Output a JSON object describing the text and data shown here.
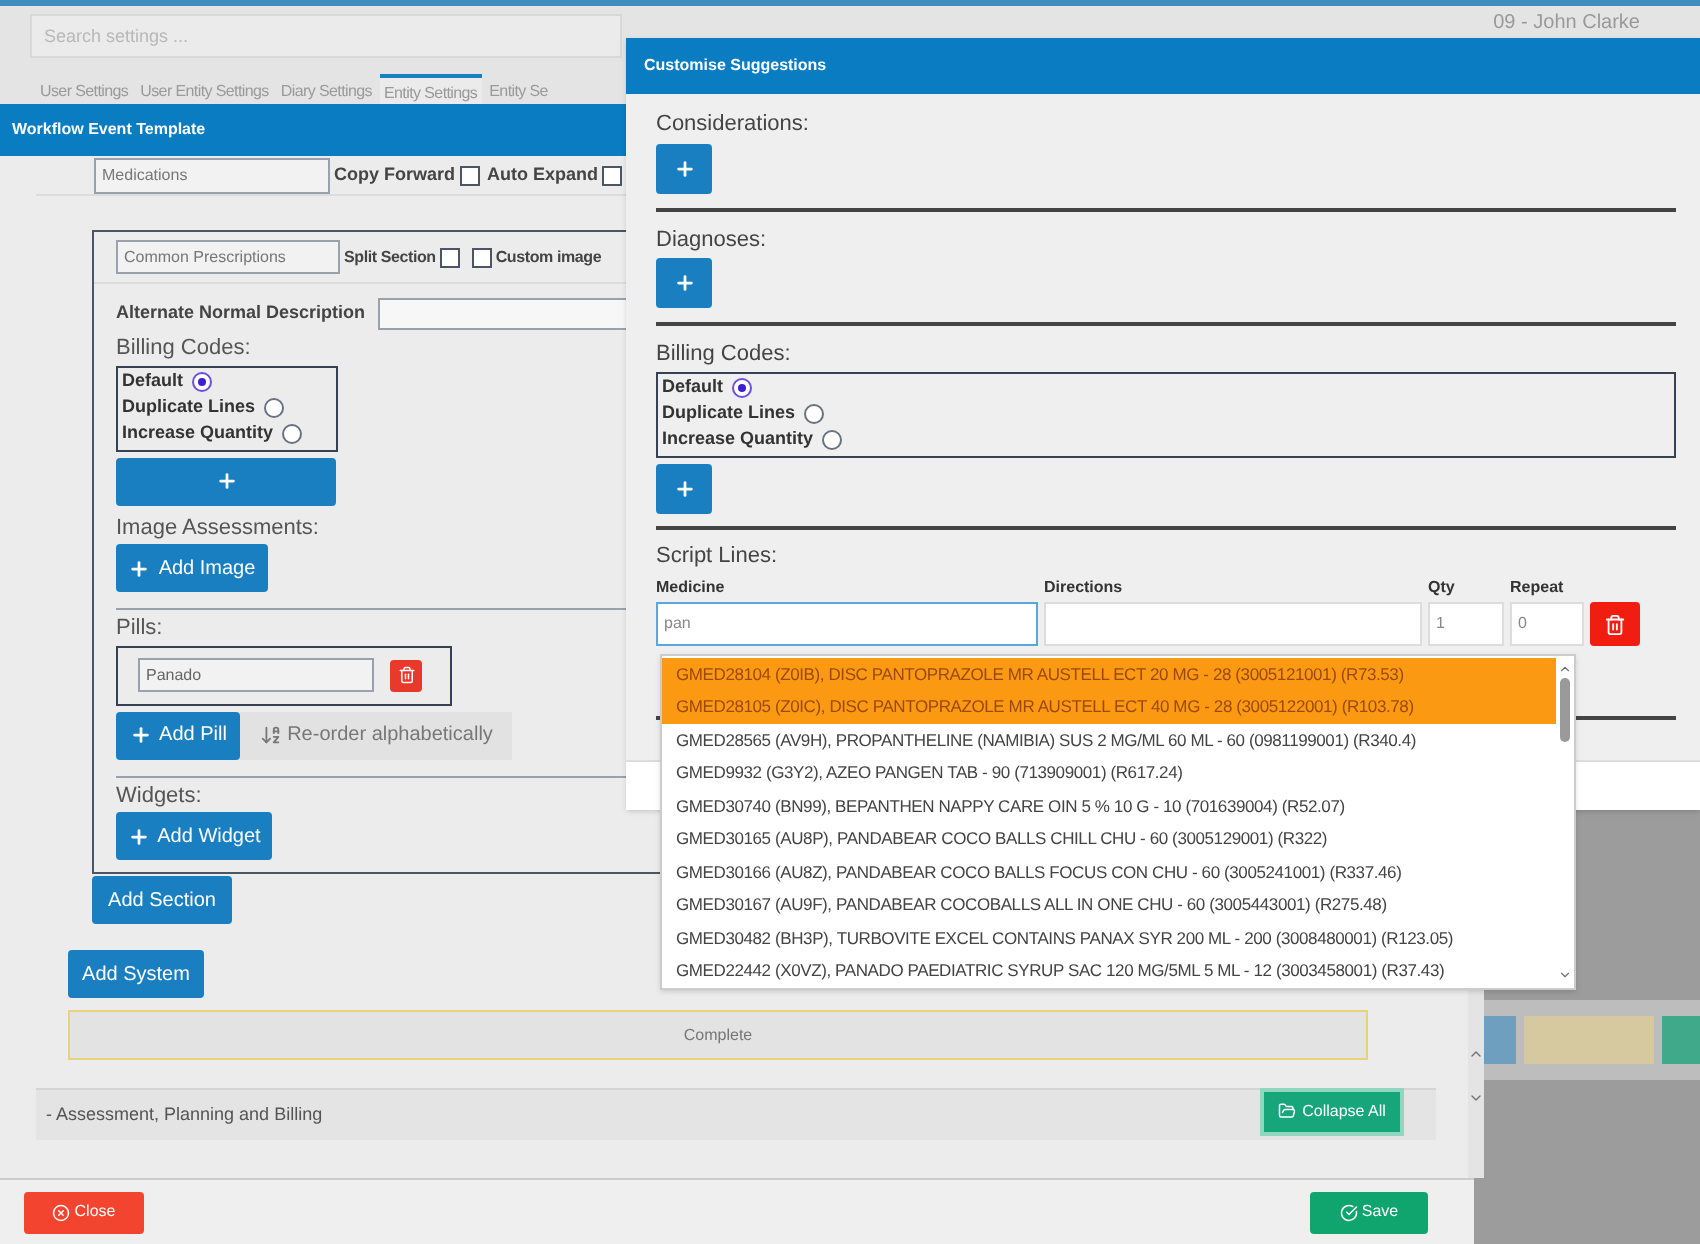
{
  "background": {
    "search": {
      "placeholder": "Search settings ..."
    },
    "user": "09 - John Clarke",
    "tabs": [
      {
        "label": "User Settings",
        "selected": false
      },
      {
        "label": "User Entity Settings",
        "selected": false
      },
      {
        "label": "Diary Settings",
        "selected": false
      },
      {
        "label": "Entity Settings",
        "selected": true
      },
      {
        "label": "Entity Se",
        "selected": false
      }
    ]
  },
  "workflow_dialog": {
    "title": "Workflow Event Template",
    "section_name": "Medications",
    "section_options": [
      {
        "label": "Copy Forward",
        "checked": false
      },
      {
        "label": "Auto Expand",
        "checked": false
      }
    ],
    "subsection": {
      "name": "Common Prescriptions",
      "options": [
        {
          "label": "Split Section",
          "checked": false
        },
        {
          "label": "Custom image",
          "checked": false
        }
      ],
      "alternate_label": "Alternate Normal Description",
      "billing_label": "Billing Codes:",
      "billing_options": [
        {
          "label": "Default",
          "selected": true
        },
        {
          "label": "Duplicate Lines",
          "selected": false
        },
        {
          "label": "Increase Quantity",
          "selected": false
        }
      ],
      "image_label": "Image Assessments:",
      "add_image": "Add Image",
      "pills_label": "Pills:",
      "pills": [
        {
          "value": "Panado"
        }
      ],
      "add_pill": "Add Pill",
      "reorder": "Re-order alphabetically",
      "widgets_label": "Widgets:",
      "add_widget": "Add Widget"
    },
    "add_section": "Add Section",
    "add_system": "Add System",
    "complete": "Complete",
    "accordion": "- Assessment, Planning and Billing",
    "collapse_all": "Collapse All",
    "close": "Close",
    "save": "Save"
  },
  "suggestions_dialog": {
    "title": "Customise Suggestions",
    "considerations_label": "Considerations:",
    "diagnoses_label": "Diagnoses:",
    "billing_label": "Billing Codes:",
    "billing_options": [
      {
        "label": "Default",
        "selected": true
      },
      {
        "label": "Duplicate Lines",
        "selected": false
      },
      {
        "label": "Increase Quantity",
        "selected": false
      }
    ],
    "script_label": "Script Lines:",
    "columns": [
      "Medicine",
      "Directions",
      "Qty",
      "Repeat"
    ],
    "script_line": {
      "medicine": "pan",
      "qty": "1",
      "repeat": "0"
    }
  },
  "dropdown": {
    "items": [
      {
        "text": "GMED28104 (Z0IB), DISC PANTOPRAZOLE MR AUSTELL ECT 20 MG - 28 (3005121001) (R73.53)",
        "selected": true
      },
      {
        "text": "GMED28105 (Z0IC), DISC PANTOPRAZOLE MR AUSTELL ECT 40 MG - 28 (3005122001) (R103.78)",
        "selected": true
      },
      {
        "text": "GMED28565 (AV9H), PROPANTHELINE (NAMIBIA) SUS 2 MG/ML 60 ML - 60 (0981199001) (R340.4)",
        "selected": false
      },
      {
        "text": "GMED9932 (G3Y2), AZEO PANGEN TAB - 90 (713909001) (R617.24)",
        "selected": false
      },
      {
        "text": "GMED30740 (BN99), BEPANTHEN NAPPY CARE OIN 5 % 10 G - 10 (701639004) (R52.07)",
        "selected": false
      },
      {
        "text": "GMED30165 (AU8P), PANDABEAR COCO BALLS CHILL CHU - 60 (3005129001) (R322)",
        "selected": false
      },
      {
        "text": "GMED30166 (AU8Z), PANDABEAR COCO BALLS FOCUS CON CHU - 60 (3005241001) (R337.46)",
        "selected": false
      },
      {
        "text": "GMED30167 (AU9F), PANDABEAR COCOBALLS ALL IN ONE CHU - 60 (3005443001) (R275.48)",
        "selected": false
      },
      {
        "text": "GMED30482 (BH3P), TURBOVITE EXCEL CONTAINS PANAX SYR 200 ML - 200 (3008480001) (R123.05)",
        "selected": false
      },
      {
        "text": "GMED22442 (X0VZ), PANADO PAEDIATRIC SYRUP SAC 120 MG/5ML 5 ML - 12 (3003458001) (R37.43)",
        "selected": false
      }
    ]
  }
}
